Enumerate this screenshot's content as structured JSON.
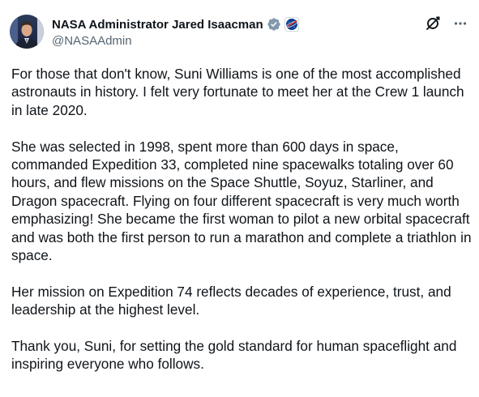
{
  "author": {
    "display_name": "NASA Administrator Jared Isaacman",
    "handle": "@NASAAdmin"
  },
  "icons": {
    "verified": "verified-badge-icon",
    "affiliation": "nasa-affiliation-icon",
    "grok": "grok-icon",
    "more": "more-options-icon"
  },
  "colors": {
    "verified": "#829aab",
    "nasa_blue": "#0b3d91",
    "nasa_red": "#fc3d21",
    "text": "#0f1419",
    "secondary_text": "#536471"
  },
  "post": {
    "paragraphs": [
      "For those that don't know, Suni Williams is one of the most accomplished astronauts in history. I felt very fortunate to meet her at the Crew 1 launch in late 2020.",
      "She was selected in 1998, spent more than 600 days in space, commanded Expedition 33, completed nine spacewalks totaling over 60 hours, and flew missions on the Space Shuttle, Soyuz, Starliner, and Dragon spacecraft. Flying on four different spacecraft is very much worth emphasizing! She became the first woman to pilot a new orbital spacecraft and was both the first person to run a marathon and complete a triathlon in space.",
      "Her mission on Expedition 74 reflects decades of experience, trust, and leadership at the highest level.",
      "Thank you, Suni, for setting the gold standard for human spaceflight and inspiring everyone who follows."
    ]
  }
}
